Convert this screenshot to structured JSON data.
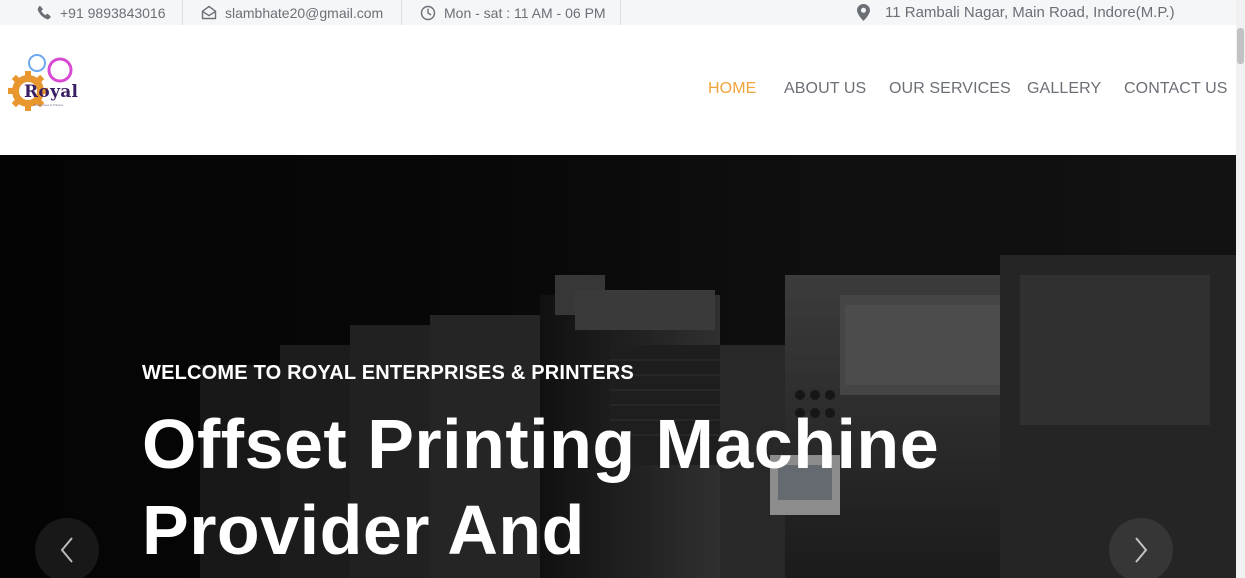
{
  "topbar": {
    "phone": "+91 9893843016",
    "email": "slambhate20@gmail.com",
    "hours": "Mon - sat : 11 AM - 06 PM",
    "address": "11 Rambali Nagar, Main Road, Indore(M.P.)",
    "icons": [
      "phone-icon",
      "envelope-icon",
      "clock-icon",
      "map-pin-icon"
    ]
  },
  "brand": {
    "logo_text": "Royal",
    "tagline": "Enterprises & Printers",
    "colors": {
      "gear": "#e8962e",
      "ring_blue": "#6ea8f0",
      "ring_pink": "#d64bd1",
      "text": "#3b1f63"
    }
  },
  "nav": {
    "items": [
      {
        "label": "HOME",
        "active": true
      },
      {
        "label": "ABOUT US",
        "active": false
      },
      {
        "label": "OUR SERVICES",
        "active": false
      },
      {
        "label": "GALLERY",
        "active": false
      },
      {
        "label": "CONTACT US",
        "active": false
      }
    ],
    "active_color": "#f3a33b",
    "text_color": "#6b6f76"
  },
  "hero": {
    "kicker": "WELCOME TO ROYAL ENTERPRISES & PRINTERS",
    "title_line1": "Offset Printing Machine",
    "title_line2": "Provider And",
    "prev_icon": "chevron-left-icon",
    "next_icon": "chevron-right-icon"
  }
}
